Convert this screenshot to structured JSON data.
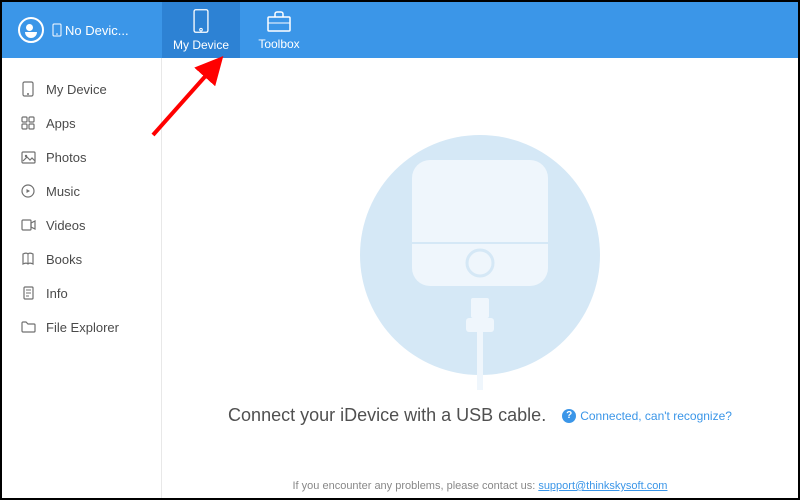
{
  "header": {
    "device_status": "No Devic..."
  },
  "topnav": [
    {
      "label": "My Device",
      "active": true
    },
    {
      "label": "Toolbox",
      "active": false
    }
  ],
  "sidebar": {
    "items": [
      {
        "label": "My Device"
      },
      {
        "label": "Apps"
      },
      {
        "label": "Photos"
      },
      {
        "label": "Music"
      },
      {
        "label": "Videos"
      },
      {
        "label": "Books"
      },
      {
        "label": "Info"
      },
      {
        "label": "File Explorer"
      }
    ]
  },
  "content": {
    "prompt": "Connect your iDevice with a USB cable.",
    "help_text": "Connected, can't recognize?"
  },
  "footer": {
    "pre_text": "If you encounter any problems, please contact us:  ",
    "email": "support@thinkskysoft.com"
  },
  "colors": {
    "primary": "#3b96e8",
    "primary_dark": "#2d82d4",
    "illustration": "#d5e8f6"
  }
}
